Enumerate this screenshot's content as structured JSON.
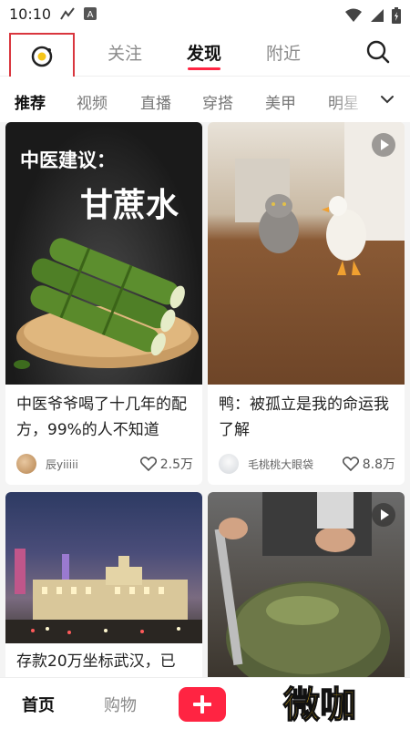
{
  "status_bar": {
    "time": "10:10"
  },
  "top_nav": {
    "tabs": [
      {
        "label": "关注",
        "active": false
      },
      {
        "label": "发现",
        "active": true
      },
      {
        "label": "附近",
        "active": false
      }
    ]
  },
  "categories": [
    {
      "label": "推荐",
      "active": true
    },
    {
      "label": "视频"
    },
    {
      "label": "直播"
    },
    {
      "label": "穿搭"
    },
    {
      "label": "美甲"
    },
    {
      "label": "明星"
    }
  ],
  "feed": [
    {
      "image_overlay_title": "中医建议：",
      "image_overlay_big": "甘蔗水",
      "title": "中医爷爷喝了十几年的配方，99%的人不知道",
      "author": "辰yiiiii",
      "likes": "2.5万",
      "is_video": false
    },
    {
      "title": "鸭：被孤立是我的命运我了解",
      "author": "毛桃桃大眼袋",
      "likes": "8.8万",
      "is_video": true
    },
    {
      "title": "存款20万坐标武汉，已",
      "is_video": false
    },
    {
      "is_video": true
    }
  ],
  "bottom_nav": {
    "home": "首页",
    "shop": "购物"
  },
  "watermark": "微咖",
  "colors": {
    "accent": "#ff2442",
    "watermark": "#f6c21c"
  }
}
